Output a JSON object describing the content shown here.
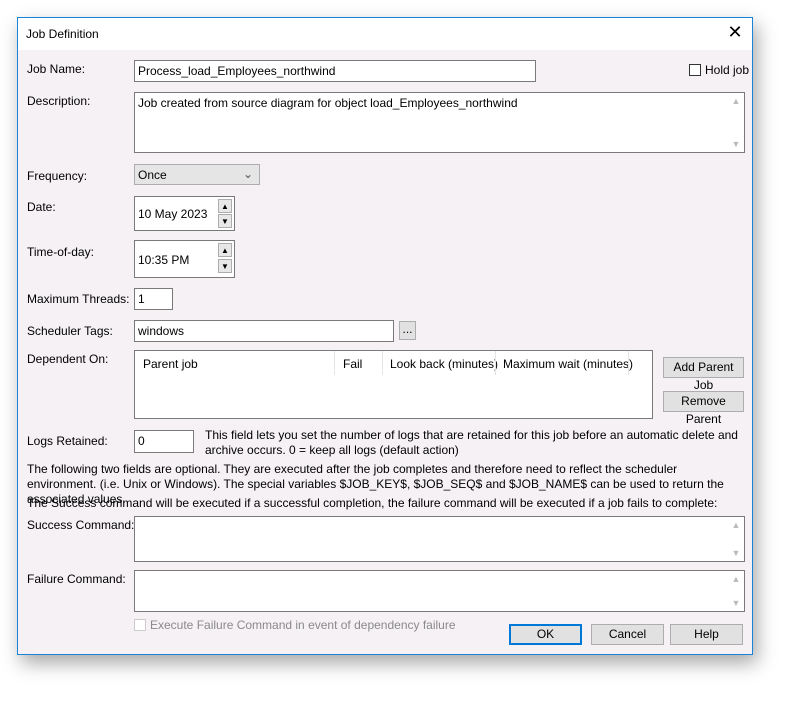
{
  "title": "Job Definition",
  "labels": {
    "job_name": "Job Name:",
    "description": "Description:",
    "frequency": "Frequency:",
    "date": "Date:",
    "time": "Time-of-day:",
    "max_threads": "Maximum Threads:",
    "scheduler_tags": "Scheduler Tags:",
    "dependent_on": "Dependent On:",
    "logs_retained": "Logs Retained:",
    "success_command": "Success Command:",
    "failure_command": "Failure Command:"
  },
  "fields": {
    "job_name": "Process_load_Employees_northwind",
    "description": "Job created from source diagram for object load_Employees_northwind",
    "frequency": "Once",
    "date": "10 May 2023",
    "time": "10:35 PM",
    "max_threads": "1",
    "scheduler_tags": "windows",
    "logs_retained": "0",
    "success_command": "",
    "failure_command": ""
  },
  "hold_job": {
    "label": "Hold job",
    "checked": false
  },
  "browse_label": "...",
  "dependent_columns": [
    "Parent job",
    "Fail",
    "Look back (minutes)",
    "Maximum wait (minutes)"
  ],
  "buttons": {
    "add_parent": "Add Parent Job",
    "remove_parent": "Remove Parent",
    "ok": "OK",
    "cancel": "Cancel",
    "help": "Help"
  },
  "logs_help": "This field lets you set the number of logs that are retained for this job before an automatic delete and archive occurs. 0 = keep all logs (default action)",
  "info1": "The following two fields are optional. They are executed after the job completes and therefore need to reflect the scheduler environment. (i.e. Unix or Windows). The special variables $JOB_KEY$, $JOB_SEQ$ and $JOB_NAME$ can be used to return the associated values.",
  "info2": "The Success command will be executed if a successful completion, the failure command will be executed if a job fails to complete:",
  "exec_failure": {
    "label": "Execute Failure Command in event of dependency failure",
    "checked": false,
    "disabled": true
  }
}
